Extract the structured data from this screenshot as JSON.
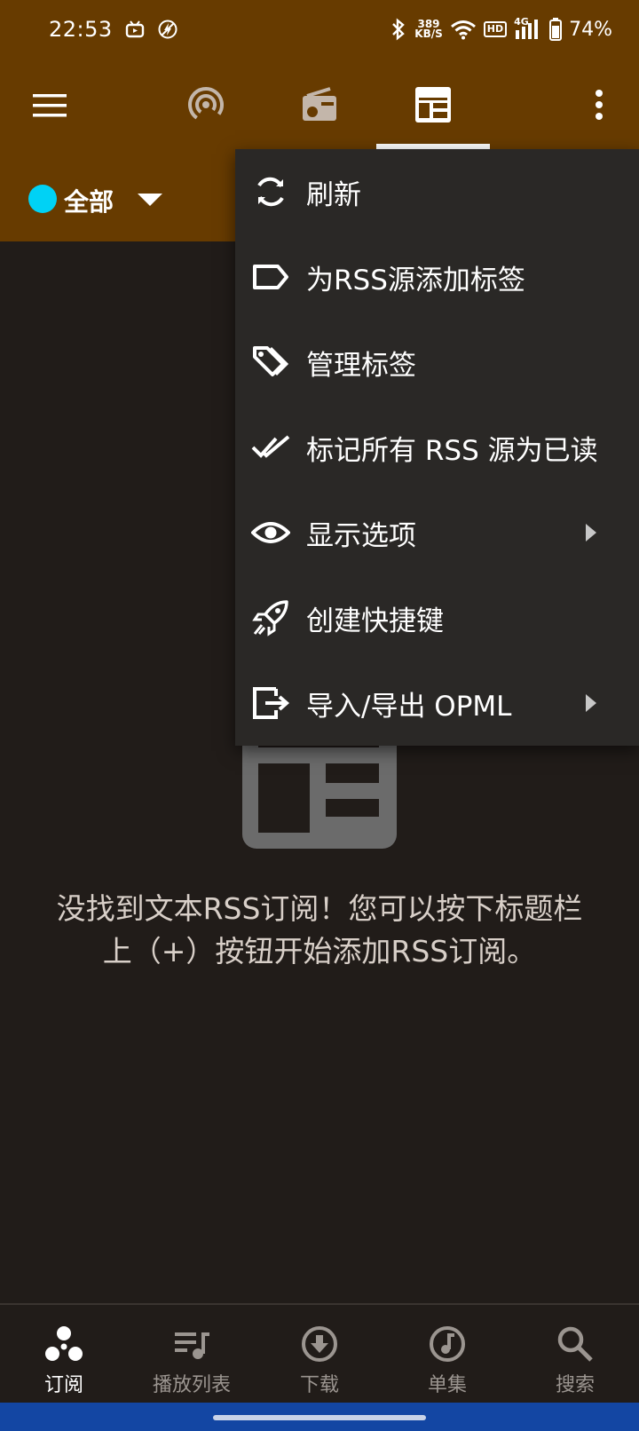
{
  "status_bar": {
    "time": "22:53",
    "net_speed_value": "389",
    "net_speed_unit": "KB/S",
    "hd_label": "HD",
    "network_label": "4G",
    "battery": "74%"
  },
  "app_bar": {
    "tabs": [
      {
        "icon": "podcast-icon",
        "active": false
      },
      {
        "icon": "radio-icon",
        "active": false
      },
      {
        "icon": "rss-feed-icon",
        "active": true
      }
    ]
  },
  "filter": {
    "label": "全部",
    "dot_color": "#00d2f5"
  },
  "menu": {
    "items": [
      {
        "label": "刷新",
        "icon": "refresh-icon",
        "submenu": false
      },
      {
        "label": "为RSS源添加标签",
        "icon": "tag-icon",
        "submenu": false
      },
      {
        "label": "管理标签",
        "icon": "tags-icon",
        "submenu": false
      },
      {
        "label": "标记所有 RSS 源为已读",
        "icon": "double-check-icon",
        "submenu": false
      },
      {
        "label": "显示选项",
        "icon": "eye-icon",
        "submenu": true
      },
      {
        "label": "创建快捷键",
        "icon": "rocket-icon",
        "submenu": false
      },
      {
        "label": "导入/导出 OPML",
        "icon": "export-icon",
        "submenu": true
      }
    ]
  },
  "empty_state": {
    "line1": "没找到文本RSS订阅！您可以按下标题栏",
    "line2": "上（+）按钮开始添加RSS订阅。"
  },
  "bottom_nav": {
    "items": [
      {
        "label": "订阅",
        "icon": "subscriptions-icon",
        "active": true
      },
      {
        "label": "播放列表",
        "icon": "playlist-icon",
        "active": false
      },
      {
        "label": "下载",
        "icon": "download-icon",
        "active": false
      },
      {
        "label": "单集",
        "icon": "episode-icon",
        "active": false
      },
      {
        "label": "搜索",
        "icon": "search-icon",
        "active": false
      }
    ]
  },
  "colors": {
    "header": "#673b00",
    "background": "#211c19",
    "menu": "#2a2826",
    "accent_dot": "#00d2f5",
    "gesture_bar": "#1346a3"
  }
}
